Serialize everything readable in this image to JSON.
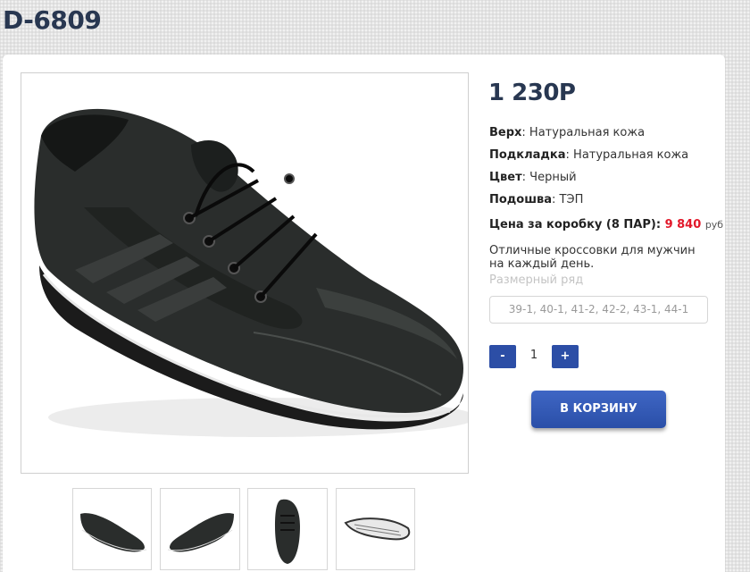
{
  "product": {
    "code": "D-6809",
    "price": "1 230Р"
  },
  "specs": [
    {
      "label": "Верх",
      "value": ": Натуральная кожа"
    },
    {
      "label": "Подкладка",
      "value": ": Натуральная кожа"
    },
    {
      "label": "Цвет",
      "value": ": Черный"
    },
    {
      "label": "Подошва",
      "value": ": ТЭП"
    }
  ],
  "box_price": {
    "label": "Цена за коробку (8 ПАР):",
    "value": "9 840",
    "currency": "руб",
    "color": "#e2182a"
  },
  "description": "Отличные кроссовки для мужчин на каждый день.",
  "size": {
    "label": "Размерный ряд",
    "value": "39-1, 40-1, 41-2, 42-2, 43-1, 44-1"
  },
  "quantity": {
    "minus": "-",
    "value": "1",
    "plus": "+"
  },
  "cart_button": "В КОРЗИНУ",
  "colors": {
    "accent": "#2c4ea6",
    "title": "#283751",
    "price_red": "#e2182a"
  }
}
